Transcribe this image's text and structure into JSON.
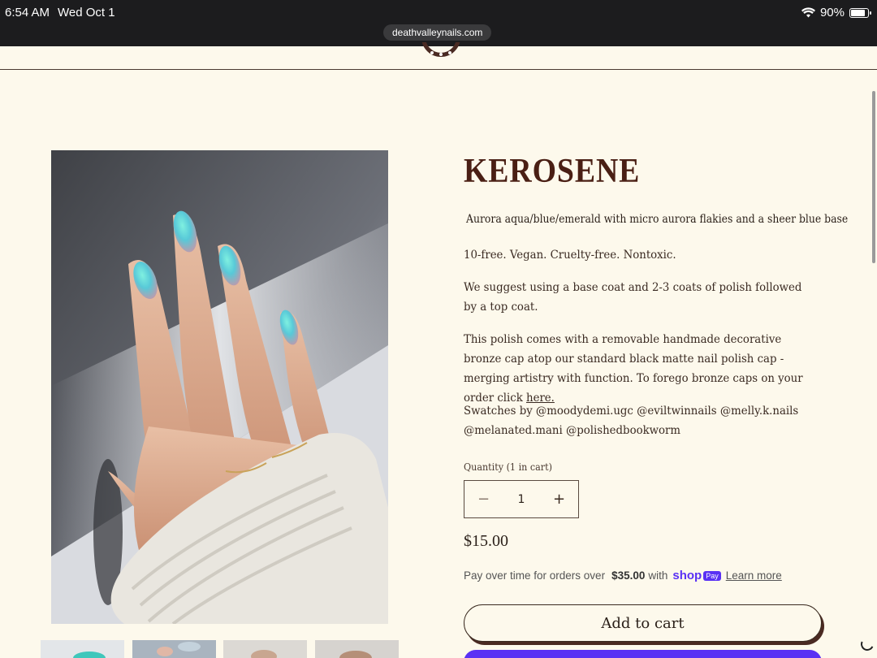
{
  "status_bar": {
    "time": "6:54 AM",
    "date": "Wed Oct 1",
    "battery": "90%",
    "battery_level": 0.9,
    "url": "deathvalleynails.com"
  },
  "product": {
    "title": "KEROSENE",
    "tagline": "Aurora aqua/blue/emerald with micro aurora flakies and a sheer blue base",
    "features": "10-free. Vegan. Cruelty-free. Nontoxic.",
    "application": "We suggest using a base coat and 2-3 coats of polish followed by a top coat.",
    "cap_text": "This polish comes with a removable handmade decorative bronze cap atop our standard black matte nail polish cap - merging artistry with function. To forego bronze caps on your order click ",
    "cap_link": "here.",
    "swatches": "Swatches by @moodydemi.ugc @eviltwinnails @melly.k.nails @melanated.mani @polishedbookworm",
    "quantity_label": "Quantity (1 in cart)",
    "quantity": "1",
    "minus": "−",
    "plus": "+",
    "price": "$15.00"
  },
  "payment": {
    "text_before": "Pay over time for orders over",
    "threshold": "$35.00",
    "text_after": "with",
    "shop_logo": "shop",
    "pay_badge": "Pay",
    "learn_more": "Learn more"
  },
  "buttons": {
    "add_to_cart": "Add to cart"
  },
  "colors": {
    "background": "#fdf9ec",
    "title": "#4a1f14",
    "shop_pay": "#5a31f4",
    "status_bar": "#1c1c1e"
  }
}
